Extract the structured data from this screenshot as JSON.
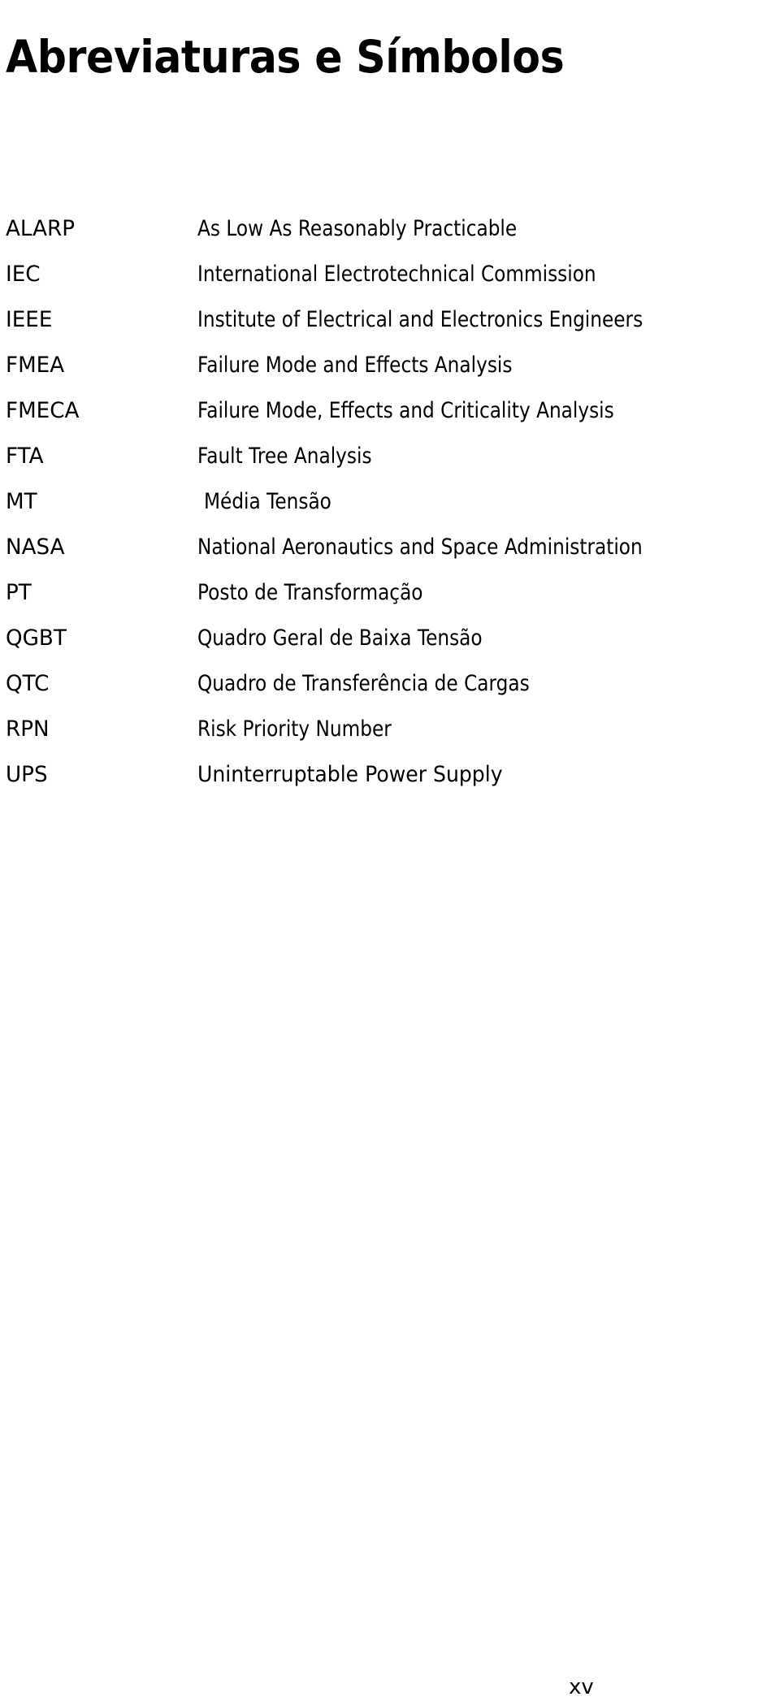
{
  "document": {
    "title": "Abreviaturas e Símbolos",
    "page_number": "xv"
  },
  "abbreviations": [
    {
      "term": "ALARP",
      "definition": "As Low As Reasonably Practicable"
    },
    {
      "term": "IEC",
      "definition": "International Electrotechnical Commission"
    },
    {
      "term": "IEEE",
      "definition": "Institute of Electrical and Electronics Engineers"
    },
    {
      "term": "FMEA",
      "definition": "Failure Mode and Effects Analysis"
    },
    {
      "term": "FMECA",
      "definition": "Failure Mode, Effects and Criticality Analysis"
    },
    {
      "term": "FTA",
      "definition": "Fault Tree Analysis"
    },
    {
      "term": "MT",
      "definition": "Média Tensão"
    },
    {
      "term": "NASA",
      "definition": "National Aeronautics and Space Administration"
    },
    {
      "term": "PT",
      "definition": "Posto de Transformação"
    },
    {
      "term": "QGBT",
      "definition": "Quadro Geral de Baixa Tensão"
    },
    {
      "term": "QTC",
      "definition": "Quadro de Transferência de Cargas"
    },
    {
      "term": "RPN",
      "definition": "Risk Priority Number"
    },
    {
      "term": "UPS",
      "definition": "Uninterruptable Power Supply"
    }
  ]
}
